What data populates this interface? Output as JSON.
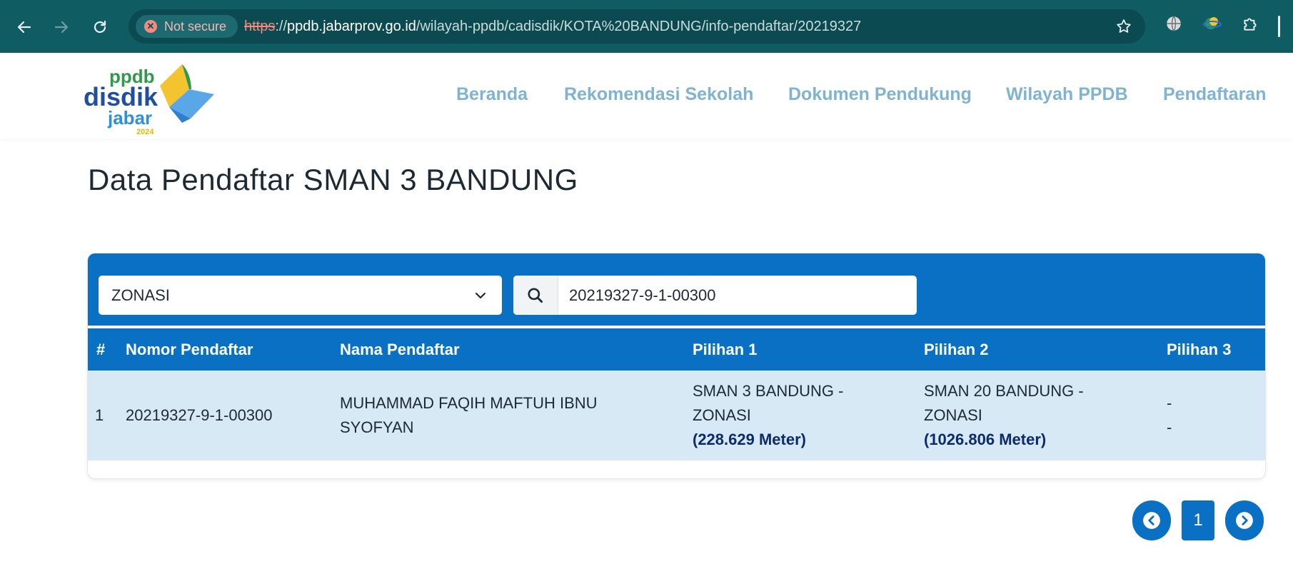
{
  "browser": {
    "security_label": "Not secure",
    "url_scheme": "https",
    "url_sep": "://",
    "url_host": "ppdb.jabarprov.go.id",
    "url_path": "/wilayah-ppdb/cadisdik/KOTA%20BANDUNG/info-pendaftar/20219327"
  },
  "logo": {
    "line1": "ppdb",
    "line2": "disdik",
    "line3": "jabar",
    "year": "2024"
  },
  "nav": {
    "items": [
      "Beranda",
      "Rekomendasi Sekolah",
      "Dokumen Pendukung",
      "Wilayah PPDB",
      "Pendaftaran"
    ]
  },
  "page": {
    "title": "Data Pendaftar SMAN 3 BANDUNG"
  },
  "filters": {
    "jalur_value": "ZONASI",
    "search_value": "20219327-9-1-00300"
  },
  "table": {
    "headers": [
      "#",
      "Nomor Pendaftar",
      "Nama Pendaftar",
      "Pilihan 1",
      "Pilihan 2",
      "Pilihan 3"
    ],
    "rows": [
      {
        "no": "1",
        "nomor": "20219327-9-1-00300",
        "nama_line1": "MUHAMMAD FAQIH MAFTUH IBNU",
        "nama_line2": "SYOFYAN",
        "pilihan1_line1": "SMAN 3 BANDUNG -",
        "pilihan1_line2": "ZONASI",
        "pilihan1_dist": "(228.629 Meter)",
        "pilihan2_line1": "SMAN 20 BANDUNG -",
        "pilihan2_line2": "ZONASI",
        "pilihan2_dist": "(1026.806 Meter)",
        "pilihan3_line1": "-",
        "pilihan3_line2": "-"
      }
    ]
  },
  "pagination": {
    "current_page": "1"
  },
  "colors": {
    "primary": "#0a70c4",
    "row_bg": "#d6e9f5",
    "nav_text": "#7fb3cf",
    "chrome": "#0f5c63"
  }
}
